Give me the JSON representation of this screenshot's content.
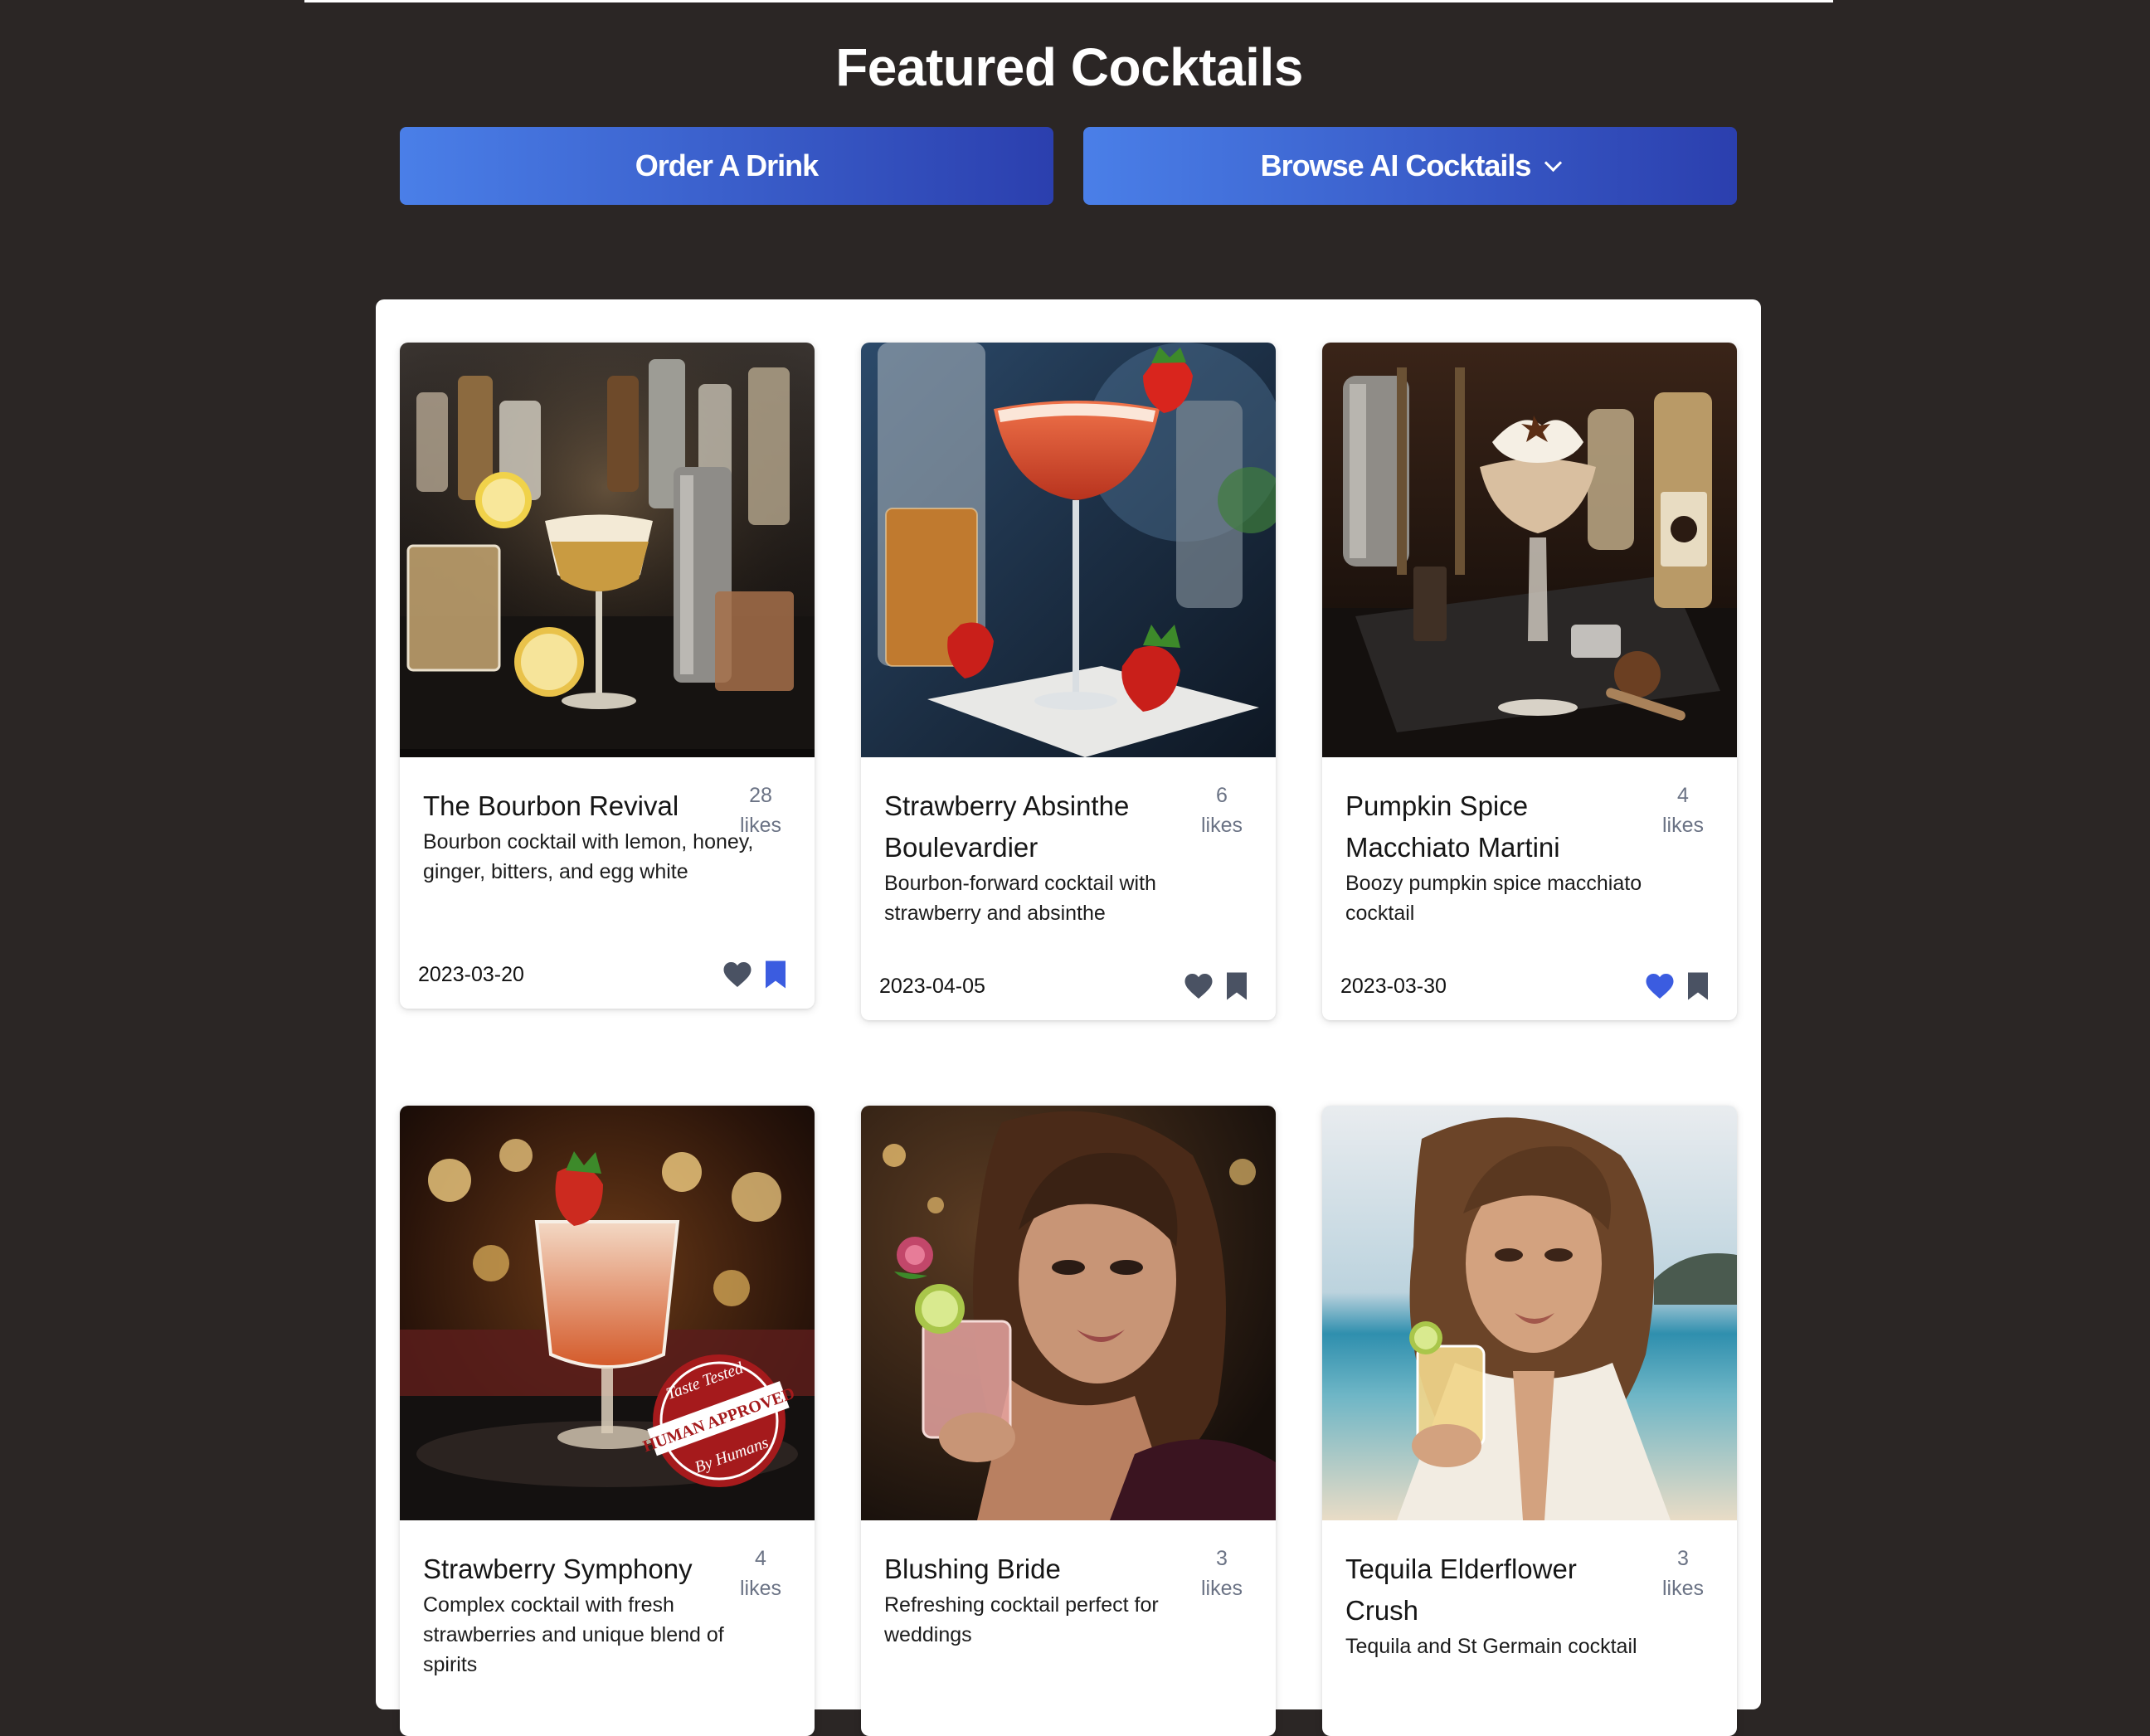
{
  "header": {
    "title": "Featured Cocktails"
  },
  "actions": {
    "order_label": "Order A Drink",
    "browse_label": "Browse AI Cocktails"
  },
  "colors": {
    "accent": "#3b5ce0",
    "icon_default": "#4a5263",
    "background": "#2b2625"
  },
  "cocktails": [
    {
      "title": "The Bourbon Revival",
      "likes_count": "28",
      "likes_label": "likes",
      "description": "Bourbon cocktail with lemon, honey, ginger, bitters, and egg white",
      "date": "2023-03-20",
      "liked": false,
      "saved": true
    },
    {
      "title": "Strawberry Absinthe Boulevardier",
      "likes_count": "6",
      "likes_label": "likes",
      "description": "Bourbon-forward cocktail with strawberry and absinthe",
      "date": "2023-04-05",
      "liked": false,
      "saved": false
    },
    {
      "title": "Pumpkin Spice Macchiato Martini",
      "likes_count": "4",
      "likes_label": "likes",
      "description": "Boozy pumpkin spice macchiato cocktail",
      "date": "2023-03-30",
      "liked": true,
      "saved": false
    },
    {
      "title": "Strawberry Symphony",
      "likes_count": "4",
      "likes_label": "likes",
      "description": "Complex cocktail with fresh strawberries and unique blend of spirits",
      "badge_top": "Taste Tested",
      "badge_middle": "HUMAN APPROVED",
      "badge_bottom": "By Humans"
    },
    {
      "title": "Blushing Bride",
      "likes_count": "3",
      "likes_label": "likes",
      "description": "Refreshing cocktail perfect for weddings"
    },
    {
      "title": "Tequila Elderflower Crush",
      "likes_count": "3",
      "likes_label": "likes",
      "description": "Tequila and St Germain cocktail"
    }
  ]
}
